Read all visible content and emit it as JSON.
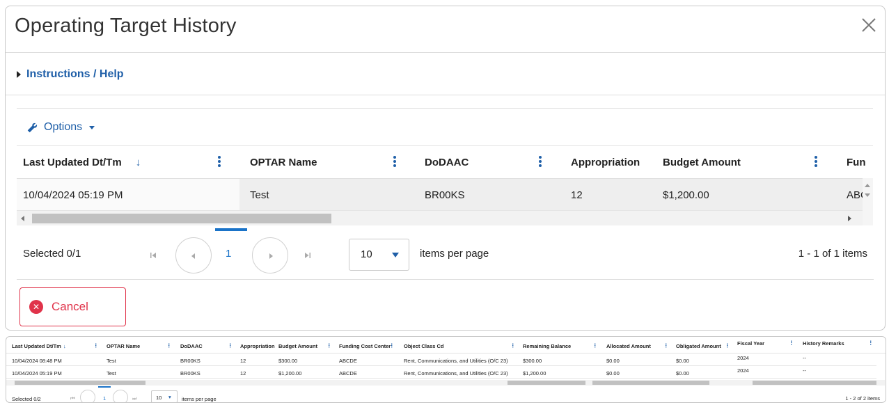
{
  "modal": {
    "title": "Operating Target History",
    "help_label": "Instructions / Help",
    "options_label": "Options",
    "columns": [
      "Last Updated Dt/Tm",
      "OPTAR Name",
      "DoDAAC",
      "Appropriation",
      "Budget Amount",
      "Fun"
    ],
    "sort_indicator": "↓",
    "row": [
      "10/04/2024 05:19 PM",
      "Test",
      "BR00KS",
      "12",
      "$1,200.00",
      "ABC"
    ],
    "pager": {
      "selected": "Selected 0/1",
      "page": "1",
      "page_size": "10",
      "items_per_page": "items per page",
      "summary": "1 - 1 of 1 items"
    },
    "cancel_label": "Cancel"
  },
  "background_grid": {
    "columns": [
      "Last Updated Dt/Tm",
      "OPTAR Name",
      "DoDAAC",
      "Appropriation",
      "Budget Amount",
      "Funding Cost Center",
      "Object Class Cd",
      "Remaining Balance",
      "Allocated Amount",
      "Obligated Amount",
      "Fiscal Year",
      "History Remarks"
    ],
    "sort_indicator": "↓",
    "rows": [
      [
        "10/04/2024 08:48 PM",
        "Test",
        "BR00KS",
        "12",
        "$300.00",
        "ABCDE",
        "Rent, Communications, and Utilities (O/C 23)",
        "$300.00",
        "$0.00",
        "$0.00",
        "2024",
        "--"
      ],
      [
        "10/04/2024 05:19 PM",
        "Test",
        "BR00KS",
        "12",
        "$1,200.00",
        "ABCDE",
        "Rent, Communications, and Utilities (O/C 23)",
        "$1,200.00",
        "$0.00",
        "$0.00",
        "2024",
        "--"
      ]
    ],
    "pager": {
      "selected": "Selected 0/2",
      "page": "1",
      "page_size": "10",
      "items_per_page": "items per page",
      "summary": "1 - 2 of 2 items"
    }
  },
  "colors": {
    "accent": "#1f5fa8",
    "danger": "#e0334a",
    "active_page": "#1a73c8"
  }
}
